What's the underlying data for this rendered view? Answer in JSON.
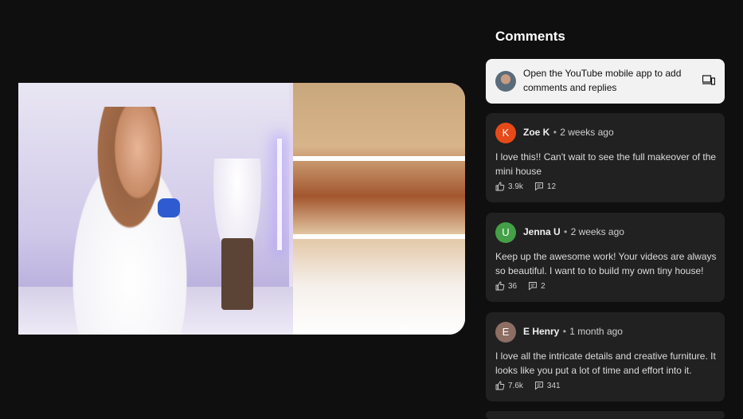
{
  "comments_panel": {
    "title": "Comments",
    "notice": "Open the YouTube mobile app to add comments and replies",
    "comments": [
      {
        "initial": "K",
        "avatar_color": "#e64a19",
        "author": "Zoe K",
        "time": "2 weeks ago",
        "text": "I love this!! Can't wait to see the full makeover of the mini house",
        "likes": "3.9k",
        "replies": "12"
      },
      {
        "initial": "U",
        "avatar_color": "#43a047",
        "author": "Jenna U",
        "time": "2 weeks ago",
        "text": "Keep up the awesome work! Your videos are always so beautiful. I want to to build my own tiny house!",
        "likes": "36",
        "replies": "2"
      },
      {
        "initial": "E",
        "avatar_color": "#8d6e63",
        "author": "E Henry",
        "time": "1 month ago",
        "text": "I love all the intricate details and creative furniture. It looks like you put a lot of time and effort into it.",
        "likes": "7.6k",
        "replies": "341"
      }
    ]
  },
  "icons": {
    "notice_device": "devices-icon",
    "like": "thumbs-up-icon",
    "reply": "comment-icon"
  }
}
